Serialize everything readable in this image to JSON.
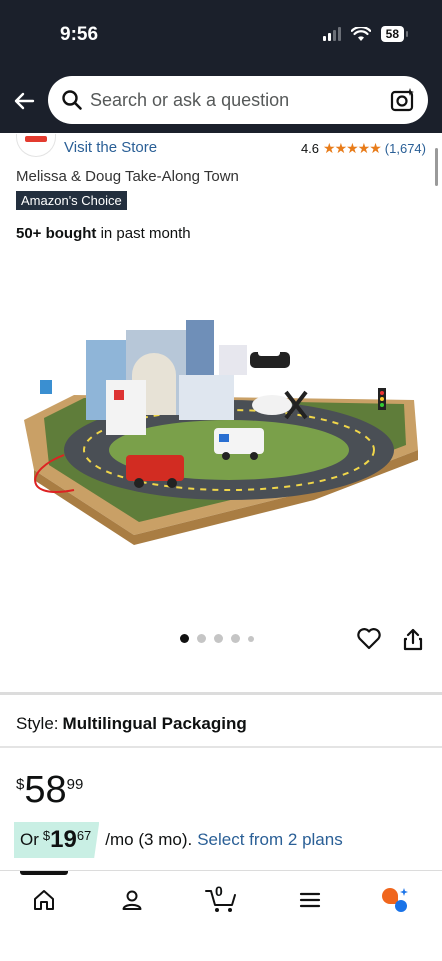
{
  "status_bar": {
    "time": "9:56",
    "battery": "58"
  },
  "search": {
    "placeholder": "Search or ask a question"
  },
  "brand": {
    "visit_store": "Visit the Store"
  },
  "rating": {
    "value": "4.6",
    "stars": "★★★★★",
    "count": "(1,674)"
  },
  "product": {
    "title": "Melissa & Doug Take-Along Town",
    "badge": "Amazon's Choice",
    "bought_bold": "50+ bought",
    "bought_rest": " in past month"
  },
  "image_carousel": {
    "total_dots": 5,
    "active_index": 0
  },
  "style": {
    "label": "Style:",
    "value": "Multilingual Packaging"
  },
  "price": {
    "symbol": "$",
    "whole": "58",
    "fraction": "99"
  },
  "plan": {
    "or_label": "Or",
    "symbol": "$",
    "whole": "19",
    "fraction": "67",
    "suffix": "/mo (3 mo).",
    "link": "Select from 2 plans"
  },
  "bottom_nav": {
    "items": [
      "home-icon",
      "account-icon",
      "cart-icon",
      "menu-icon",
      "rufus-icon"
    ],
    "cart_count": "0"
  },
  "colors": {
    "header_bg": "#1b202b",
    "link": "#2a5f96",
    "star": "#e87c1a",
    "badge_bg": "#232f3e",
    "plan_pill": "#c9efe4",
    "rufus_orange": "#f0661d",
    "rufus_blue": "#1a73e8"
  }
}
